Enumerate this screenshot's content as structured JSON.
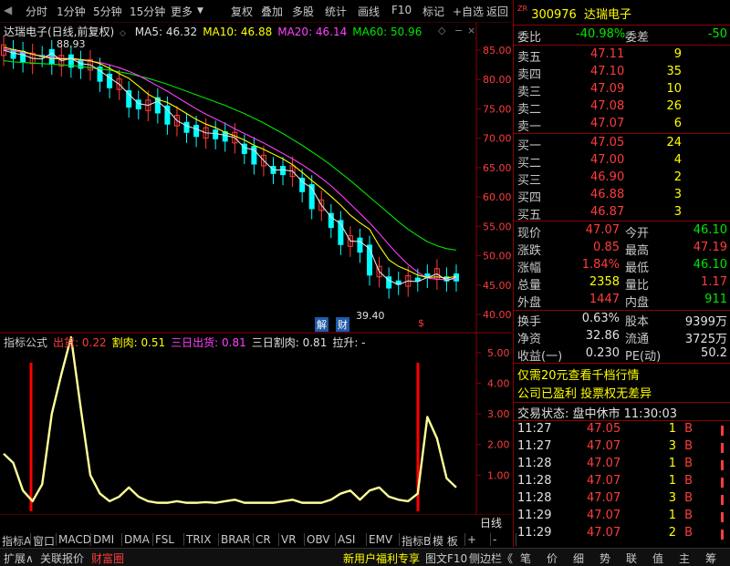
{
  "toolbar": {
    "left": [
      "分时",
      "1分钟",
      "5分钟",
      "15分钟",
      "更多"
    ],
    "right": [
      "复权",
      "叠加",
      "多股",
      "统计",
      "画线",
      "F10",
      "标记",
      "+自选",
      "返回"
    ]
  },
  "chart": {
    "title": "达瑞电子(日线,前复权)",
    "ma_items": [
      {
        "label": "MA5: 46.32",
        "color": "#e0e0e0"
      },
      {
        "label": "MA10: 46.88",
        "color": "#ffff00"
      },
      {
        "label": "MA20: 46.14",
        "color": "#ff40ff"
      },
      {
        "label": "MA60: 50.96",
        "color": "#00e600"
      }
    ],
    "price_ticks": [
      "85.00",
      "80.00",
      "75.00",
      "70.00",
      "65.00",
      "60.00",
      "55.00",
      "50.00",
      "45.00",
      "40.00"
    ],
    "high_label": "88.93",
    "low_label": "39.40",
    "marker_jie": "解",
    "marker_cai": "财",
    "marker_dollar": "$",
    "indicator_header": [
      {
        "label": "指标公式",
        "color": "#c8c8c8"
      },
      {
        "label": "出货: 0.22",
        "color": "#ff3c3c"
      },
      {
        "label": "割肉: 0.51",
        "color": "#ffff00"
      },
      {
        "label": "三日出货: 0.81",
        "color": "#ff40ff"
      },
      {
        "label": "三日割肉: 0.81",
        "color": "#e0e0e0"
      },
      {
        "label": "拉升: -",
        "color": "#e0e0e0"
      }
    ],
    "indicator_ticks": [
      "5.00",
      "4.00",
      "3.00",
      "2.00",
      "1.00"
    ],
    "time_axis": [
      "2021年",
      "1",
      "2",
      "3",
      "4",
      "5",
      "6"
    ],
    "period_label": "日线"
  },
  "chart_data": {
    "type": "line",
    "price_axis": [
      40,
      85
    ],
    "indicator_axis": [
      0,
      5
    ],
    "ma5": [
      85,
      84.5,
      84.2,
      83.6,
      83.5,
      84.5,
      83.2,
      83.6,
      82.7,
      82.5,
      81.5,
      80.3,
      79.2,
      77.5,
      75.9,
      75.6,
      76.3,
      74.9,
      73,
      72.1,
      71.6,
      70.9,
      70.8,
      70.5,
      70.1,
      68.4,
      68,
      66.2,
      64.6,
      64.6,
      64.4,
      62.6,
      61.5,
      58.6,
      56.6,
      55.4,
      52.5,
      52.4,
      51.2,
      47.3,
      45.8,
      45.1,
      45.7,
      45.6,
      46.3,
      46.9,
      45.8,
      46.3
    ],
    "ma10": [
      85.5,
      85.1,
      84.8,
      84.3,
      83.9,
      83.6,
      83.5,
      83.6,
      83.4,
      83.2,
      82.7,
      81.9,
      81,
      80.2,
      78.9,
      77.5,
      76.6,
      76.1,
      75.2,
      74.2,
      73.2,
      72.4,
      71.8,
      71,
      70.4,
      69.7,
      68.8,
      68.1,
      67.3,
      66.5,
      65.5,
      64.2,
      62.8,
      61.5,
      60.1,
      58.6,
      56.9,
      55.6,
      54.5,
      51.7,
      49.3,
      48.2,
      47.5,
      46.7,
      46.3,
      46.4,
      46.2,
      46.5
    ],
    "ma20": [
      85.2,
      84.9,
      84.6,
      84.3,
      84,
      83.8,
      83.6,
      83.5,
      83.3,
      83.1,
      82.9,
      82.5,
      82,
      81.4,
      80.7,
      79.8,
      78.9,
      78,
      77,
      76,
      75,
      74.1,
      73.3,
      72.5,
      71.6,
      70.8,
      70,
      69.2,
      68.3,
      67.4,
      66.5,
      65.5,
      64.4,
      63.2,
      61.9,
      60.4,
      58.8,
      57.2,
      55.6,
      53.8,
      51.9,
      50.1,
      48.5,
      47.2,
      46.2,
      46,
      45.9,
      46.1
    ],
    "ma60": [
      83.2,
      83,
      82.9,
      82.8,
      82.7,
      82.6,
      82.5,
      82.4,
      82.2,
      82,
      81.8,
      81.6,
      81.3,
      81,
      80.6,
      80.2,
      79.7,
      79.2,
      78.6,
      78,
      77.4,
      76.8,
      76.2,
      75.6,
      74.9,
      74.2,
      73.4,
      72.6,
      71.7,
      70.8,
      69.8,
      68.8,
      67.7,
      66.6,
      65.4,
      64.1,
      62.8,
      61.4,
      60,
      58.6,
      57.2,
      55.8,
      54.5,
      53.4,
      52.4,
      51.7,
      51.2,
      50.96
    ],
    "indicator": [
      1.7,
      1.4,
      0.5,
      0.15,
      0.7,
      3.0,
      4.3,
      5.5,
      3.2,
      1.0,
      0.4,
      0.15,
      0.3,
      0.6,
      0.3,
      0.15,
      0.1,
      0.1,
      0.15,
      0.1,
      0.1,
      0.12,
      0.1,
      0.15,
      0.2,
      0.1,
      0.1,
      0.1,
      0.1,
      0.15,
      0.2,
      0.1,
      0.1,
      0.1,
      0.2,
      0.4,
      0.5,
      0.2,
      0.5,
      0.6,
      0.3,
      0.2,
      0.15,
      0.4,
      2.9,
      2.2,
      0.9,
      0.6
    ]
  },
  "quote": {
    "code": "300976",
    "name": "达瑞电子",
    "ratio_label": "委比",
    "ratio_value": "-40.98%",
    "diff_label": "委差",
    "diff_value": "-50",
    "sell": [
      {
        "label": "卖五",
        "price": "47.11",
        "vol": "9"
      },
      {
        "label": "卖四",
        "price": "47.10",
        "vol": "35"
      },
      {
        "label": "卖三",
        "price": "47.09",
        "vol": "10"
      },
      {
        "label": "卖二",
        "price": "47.08",
        "vol": "26"
      },
      {
        "label": "卖一",
        "price": "47.07",
        "vol": "6"
      }
    ],
    "buy": [
      {
        "label": "买一",
        "price": "47.05",
        "vol": "24"
      },
      {
        "label": "买二",
        "price": "47.00",
        "vol": "4"
      },
      {
        "label": "买三",
        "price": "46.90",
        "vol": "2"
      },
      {
        "label": "买四",
        "price": "46.88",
        "vol": "3"
      },
      {
        "label": "买五",
        "price": "46.87",
        "vol": "3"
      }
    ],
    "stats": [
      {
        "l1": "现价",
        "v1": "47.07",
        "c1": "red",
        "l2": "今开",
        "v2": "46.10",
        "c2": "green"
      },
      {
        "l1": "涨跌",
        "v1": "0.85",
        "c1": "red",
        "l2": "最高",
        "v2": "47.19",
        "c2": "red"
      },
      {
        "l1": "涨幅",
        "v1": "1.84%",
        "c1": "red",
        "l2": "最低",
        "v2": "46.10",
        "c2": "green"
      },
      {
        "l1": "总量",
        "v1": "2358",
        "c1": "yellow",
        "l2": "量比",
        "v2": "1.17",
        "c2": "red"
      },
      {
        "l1": "外盘",
        "v1": "1447",
        "c1": "red",
        "l2": "内盘",
        "v2": "911",
        "c2": "green"
      }
    ],
    "fin": [
      {
        "l1": "换手",
        "v1": "0.63%",
        "l2": "股本",
        "v2": "9399万"
      },
      {
        "l1": "净资",
        "v1": "32.86",
        "l2": "流通",
        "v2": "3725万"
      },
      {
        "l1": "收益(一)",
        "v1": "0.230",
        "l2": "PE(动)",
        "v2": "50.2"
      }
    ],
    "promo": "仅需20元查看千档行情",
    "notice": "公司已盈利 投票权无差异",
    "status": "交易状态: 盘中休市 11:30:03",
    "ticks": [
      {
        "time": "11:27",
        "price": "47.05",
        "vol": "1",
        "bs": "B"
      },
      {
        "time": "11:27",
        "price": "47.07",
        "vol": "3",
        "bs": "B"
      },
      {
        "time": "11:28",
        "price": "47.07",
        "vol": "1",
        "bs": "B"
      },
      {
        "time": "11:28",
        "price": "47.07",
        "vol": "1",
        "bs": "B"
      },
      {
        "time": "11:28",
        "price": "47.07",
        "vol": "3",
        "bs": "B"
      },
      {
        "time": "11:29",
        "price": "47.07",
        "vol": "1",
        "bs": "B"
      },
      {
        "time": "11:29",
        "price": "47.07",
        "vol": "2",
        "bs": "B"
      }
    ]
  },
  "bottom": {
    "indicator_tabs": [
      "指标A",
      "窗口",
      "MACD",
      "DMI",
      "DMA",
      "FSL",
      "TRIX",
      "BRAR",
      "CR",
      "VR",
      "OBV",
      "ASI",
      "EMV",
      "指标B",
      "模 板",
      "+",
      "-"
    ],
    "status_tabs": [
      "扩展∧",
      "关联报价",
      "财富圈"
    ],
    "status_right": [
      "新用户福利专享",
      "图文F10",
      "侧边栏《"
    ],
    "side_tabs": [
      "笔",
      "价",
      "细",
      "势",
      "联",
      "值",
      "主",
      "筹"
    ]
  }
}
